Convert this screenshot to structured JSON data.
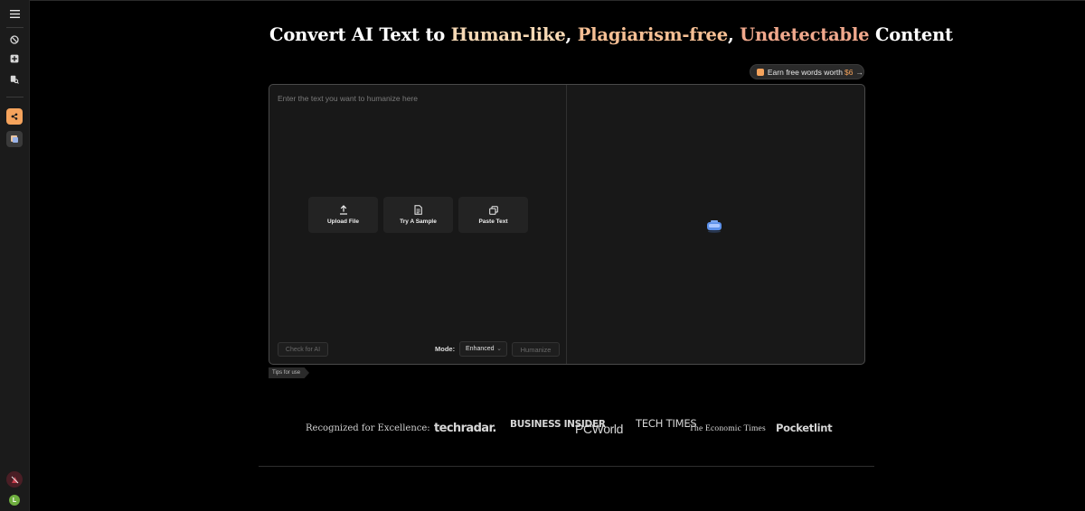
{
  "heading": {
    "part1": "Convert AI Text to ",
    "highlight1": "Human-like",
    "sep1": ", ",
    "highlight2": "Plagiarism-free",
    "sep2": ", ",
    "highlight3": "Undetectable",
    "part2": " Content"
  },
  "earn": {
    "label": "Earn free words worth",
    "amount": "$6",
    "arrow": "→"
  },
  "editor": {
    "placeholder": "Enter the text you want to humanize here",
    "options": [
      {
        "label": "Upload File",
        "icon": "upload-icon"
      },
      {
        "label": "Try A Sample",
        "icon": "document-icon"
      },
      {
        "label": "Paste Text",
        "icon": "copy-icon"
      }
    ],
    "check_button": "Check for AI",
    "mode_label": "Mode:",
    "mode_value": "Enhanced",
    "humanize_button": "Humanize"
  },
  "tips": {
    "label": "Tips for use"
  },
  "recognized": {
    "label": "Recognized for Excellence:",
    "logos": [
      "techradar.",
      "BUSINESS INSIDER",
      "PCWorld",
      "TECH TIMES",
      "The Economic Times",
      "Pocketlint"
    ]
  },
  "sidebar": {
    "icons": [
      "menu-icon",
      "block-icon",
      "add-icon",
      "search-doc-icon",
      "share-app-icon",
      "app-icon"
    ],
    "user_initial": "L",
    "colors": {
      "accent": "#f5a35c",
      "avatar": "#6fae3f",
      "promo": "#c73d4c"
    }
  }
}
